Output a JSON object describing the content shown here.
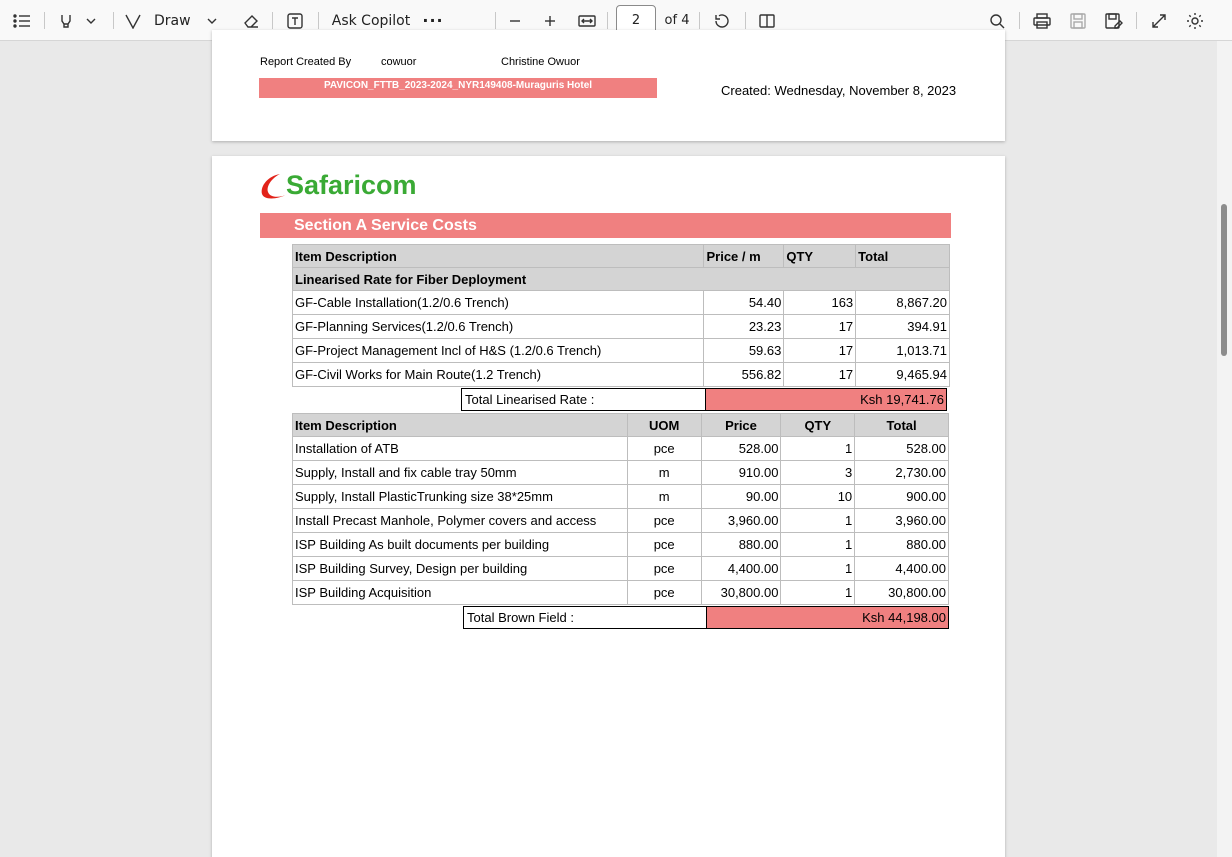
{
  "toolbar": {
    "draw_label": "Draw",
    "ask_copilot_label": "Ask Copilot",
    "page_number": "2",
    "page_count": "of 4"
  },
  "page1": {
    "report_created_by_label": "Report Created By",
    "user_id": "cowuor",
    "user_name": "Christine Owuor",
    "project_band": "PAVICON_FTTB_2023-2024_NYR149408-Muraguris Hotel",
    "created": "Created: Wednesday, November 8, 2023"
  },
  "page2": {
    "logo_text": "Safaricom",
    "section_title": "Section A Service Costs",
    "table1": {
      "headers": [
        "Item Description",
        "Price / m",
        "QTY",
        "Total"
      ],
      "group_label": "Linearised Rate for Fiber Deployment",
      "rows": [
        [
          "GF-Cable Installation(1.2/0.6 Trench)",
          "54.40",
          "163",
          "8,867.20"
        ],
        [
          "GF-Planning Services(1.2/0.6 Trench)",
          "23.23",
          "17",
          "394.91"
        ],
        [
          "GF-Project Management Incl of H&S (1.2/0.6 Trench)",
          "59.63",
          "17",
          "1,013.71"
        ],
        [
          "GF-Civil Works for Main Route(1.2 Trench)",
          "556.82",
          "17",
          "9,465.94"
        ]
      ],
      "total_label": "Total Linearised Rate :",
      "total_value": "Ksh 19,741.76"
    },
    "table2": {
      "headers": [
        "Item Description",
        "UOM",
        "Price",
        "QTY",
        "Total"
      ],
      "rows": [
        [
          "Installation of ATB",
          "pce",
          "528.00",
          "1",
          "528.00"
        ],
        [
          "Supply, Install and fix cable tray  50mm",
          "m",
          "910.00",
          "3",
          "2,730.00"
        ],
        [
          "Supply, Install PlasticTrunking size 38*25mm",
          "m",
          "90.00",
          "10",
          "900.00"
        ],
        [
          "Install Precast Manhole, Polymer covers and access",
          "pce",
          "3,960.00",
          "1",
          "3,960.00"
        ],
        [
          "ISP Building As built documents per building",
          "pce",
          "880.00",
          "1",
          "880.00"
        ],
        [
          "ISP Building Survey, Design per building",
          "pce",
          "4,400.00",
          "1",
          "4,400.00"
        ],
        [
          "ISP Building Acquisition",
          "pce",
          "30,800.00",
          "1",
          "30,800.00"
        ]
      ],
      "total_label": "Total Brown Field :",
      "total_value": "Ksh 44,198.00"
    }
  },
  "colors": {
    "accent_band": "#f08080",
    "logo_green": "#3aaa35",
    "logo_red": "#e2231a"
  }
}
